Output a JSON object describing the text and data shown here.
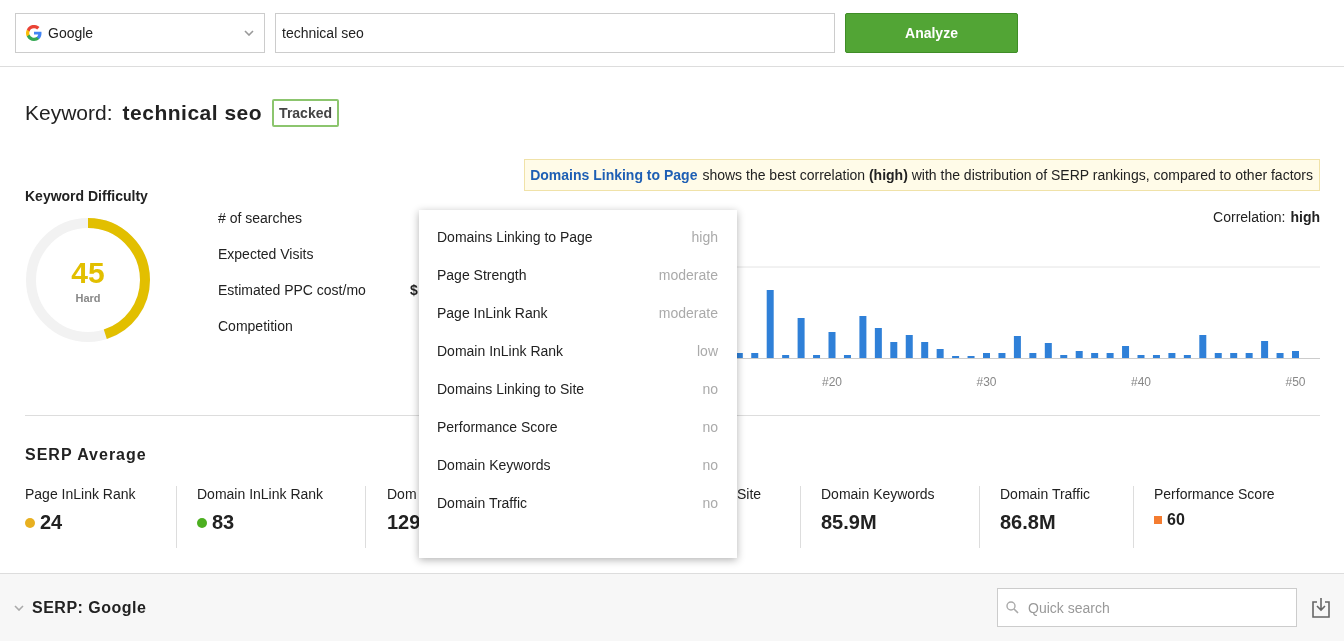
{
  "engine_select": {
    "value": "Google"
  },
  "query_field": {
    "value": "technical seo"
  },
  "analyze_button": {
    "label": "Analyze"
  },
  "keyword": {
    "prefix": "Keyword:",
    "text": "technical seo",
    "badge": "Tracked"
  },
  "keyword_difficulty": {
    "title": "Keyword Difficulty",
    "score": "45",
    "rating": "Hard",
    "level": 0.45
  },
  "metrics": [
    {
      "label": "# of searches"
    },
    {
      "label": "Expected Visits"
    },
    {
      "label": "Estimated PPC cost/mo",
      "value": "$"
    },
    {
      "label": "Competition"
    }
  ],
  "insight": {
    "factor": "Domains Linking to Page",
    "text": "shows the best correlation **(high)** with the distribution of SERP rankings, compared to other factors"
  },
  "correlation": {
    "label": "Correlation:",
    "value": "high"
  },
  "chart": {
    "axis_labels": [
      "#20",
      "#30",
      "#40",
      "#50"
    ]
  },
  "factor_menu": [
    {
      "label": "Domains Linking to Page",
      "value": "high"
    },
    {
      "label": "Page Strength",
      "value": "moderate"
    },
    {
      "label": "Page InLink Rank",
      "value": "moderate"
    },
    {
      "label": "Domain InLink Rank",
      "value": "low"
    },
    {
      "label": "Domains Linking to Site",
      "value": "no"
    },
    {
      "label": "Performance Score",
      "value": "no"
    },
    {
      "label": "Domain Keywords",
      "value": "no"
    },
    {
      "label": "Domain Traffic",
      "value": "no"
    }
  ],
  "serp_average": {
    "title": "SERP Average",
    "items": [
      {
        "label": "Page InLink Rank",
        "value": "24",
        "kind": "dot",
        "color": "#e8b020"
      },
      {
        "label": "Domain InLink Rank",
        "value": "83",
        "kind": "dot",
        "color": "#4caf20"
      },
      {
        "label": "Dom",
        "value": "129",
        "kind": "plain"
      },
      {
        "label": "Site",
        "kind": "plain"
      },
      {
        "label": "Domain Keywords",
        "value": "85.9M",
        "kind": "plain"
      },
      {
        "label": "Domain Traffic",
        "value": "86.8M",
        "kind": "plain"
      },
      {
        "label": "Performance Score",
        "value": "60",
        "kind": "square",
        "color": "#f47c30"
      }
    ]
  },
  "serp_section": {
    "title": "SERP: Google",
    "search_placeholder": "Quick search"
  }
}
